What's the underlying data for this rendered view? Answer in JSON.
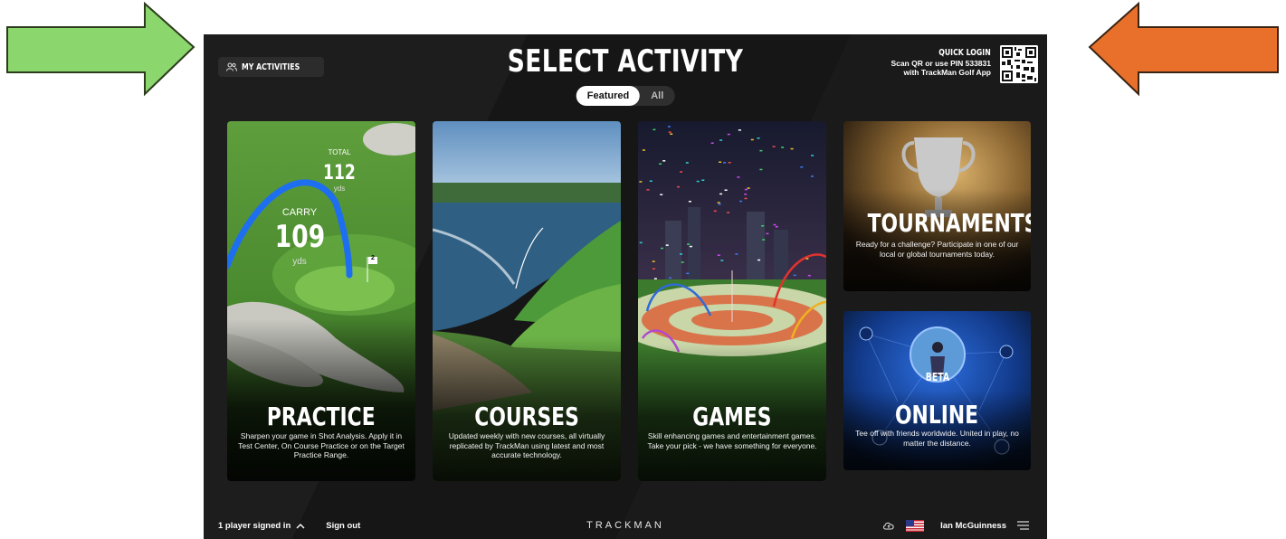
{
  "header": {
    "my_activities": "MY ACTIVITIES",
    "title": "SELECT ACTIVITY",
    "tabs": [
      {
        "label": "Featured",
        "active": true
      },
      {
        "label": "All",
        "active": false
      }
    ],
    "quick_login": {
      "title": "QUICK LOGIN",
      "line1": "Scan QR or use PIN 533831",
      "line2": "with TrackMan Golf App"
    }
  },
  "cards": {
    "practice": {
      "title": "PRACTICE",
      "description": "Sharpen your game in Shot Analysis. Apply it in Test Center, On Course Practice or on the Target Practice Range.",
      "stats": {
        "total_label": "TOTAL",
        "total_value": "112",
        "total_unit": "yds",
        "carry_label": "CARRY",
        "carry_value": "109",
        "carry_unit": "yds",
        "flag": "2"
      }
    },
    "courses": {
      "title": "COURSES",
      "description": "Updated weekly with new courses, all virtually replicated by TrackMan using latest and most accurate technology."
    },
    "games": {
      "title": "GAMES",
      "description": "Skill enhancing games and entertainment games. Take your pick - we have something for everyone."
    },
    "tournaments": {
      "title": "TOURNAMENTS",
      "description": "Ready for a challenge? Participate in one of our local or global tournaments today."
    },
    "online": {
      "title": "ONLINE",
      "badge": "BETA",
      "description": "Tee off with friends worldwide. United in play, no matter the distance."
    }
  },
  "footer": {
    "players": "1 player signed in",
    "sign_out": "Sign out",
    "brand": "TRACKMAN",
    "user": "Ian McGuinness"
  },
  "colors": {
    "left_arrow": "#8cd66e",
    "right_arrow": "#e8702a",
    "app_bg": "#161616"
  },
  "icons": [
    "arrow-right-icon",
    "arrow-left-icon",
    "people-icon",
    "qr-code-icon",
    "chevron-up-icon",
    "cloud-icon",
    "us-flag-icon",
    "menu-icon"
  ]
}
